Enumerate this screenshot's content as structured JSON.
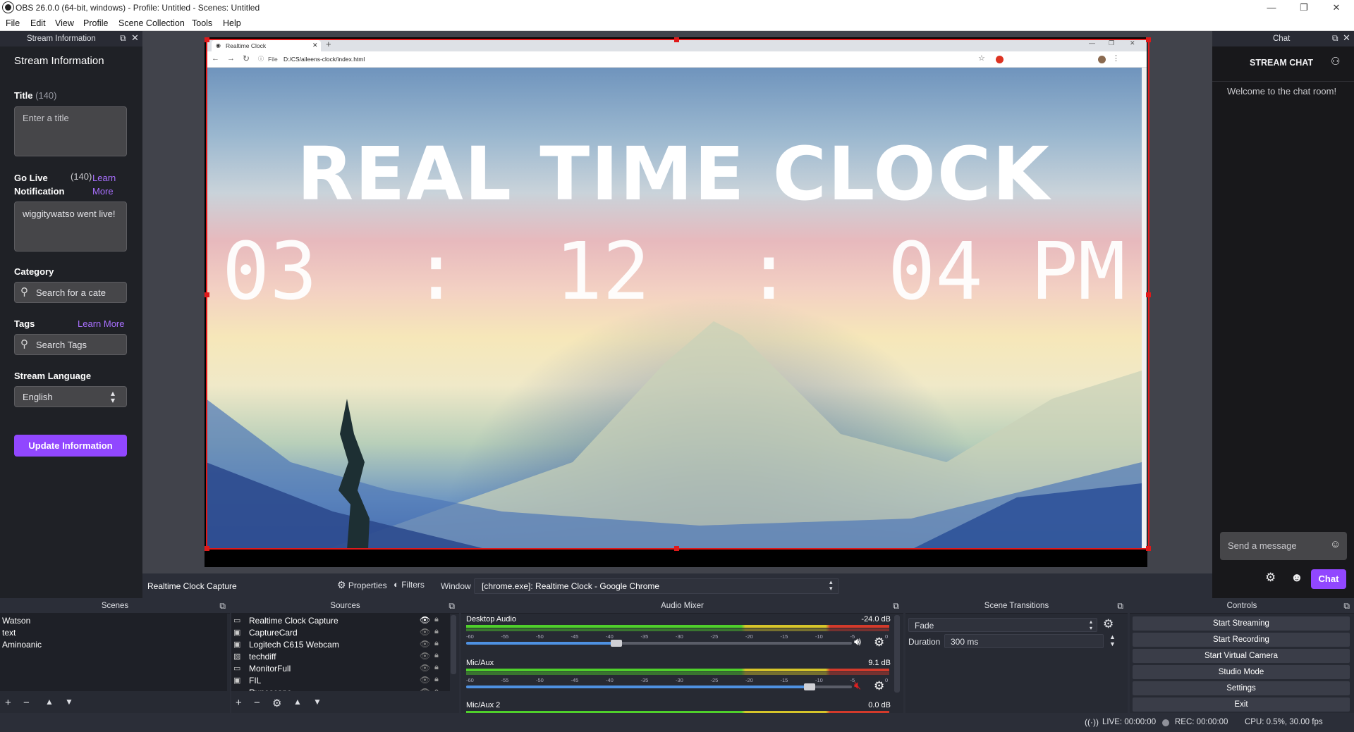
{
  "window": {
    "title": "OBS 26.0.0 (64-bit, windows) - Profile: Untitled - Scenes: Untitled",
    "minimize": "—",
    "restore": "❐",
    "close": "✕"
  },
  "menu": [
    "File",
    "Edit",
    "View",
    "Profile",
    "Scene Collection",
    "Tools",
    "Help"
  ],
  "stream_info": {
    "dock_title": "Stream Information",
    "heading": "Stream Information",
    "title_label": "Title",
    "title_count": "(140)",
    "title_placeholder": "Enter a title",
    "golive_label": "Go Live Notification",
    "golive_count": "(140)",
    "learn_more": "Learn More",
    "golive_value": "wiggitywatso went live!",
    "category_label": "Category",
    "category_placeholder": "Search for a cate",
    "tags_label": "Tags",
    "tags_learn_more": "Learn More",
    "tags_placeholder": "Search Tags",
    "language_label": "Stream Language",
    "language_value": "English",
    "update_button": "Update Information"
  },
  "browser": {
    "tab_title": "Realtime Clock",
    "url_prefix": "File",
    "url": "D:/CS/aileens-clock/index.html"
  },
  "clock": {
    "title": "REAL TIME CLOCK",
    "hours": "03",
    "minutes": "12",
    "seconds": "04",
    "ampm": "PM",
    "sep": ":"
  },
  "chat": {
    "dock_title": "Chat",
    "header": "STREAM CHAT",
    "welcome": "Welcome to the chat room!",
    "input_placeholder": "Send a message",
    "chat_button": "Chat"
  },
  "source_toolbar": {
    "source_name": "Realtime Clock Capture",
    "properties": "Properties",
    "filters": "Filters",
    "window_label": "Window",
    "window_value": "[chrome.exe]: Realtime Clock - Google Chrome"
  },
  "scenes": {
    "title": "Scenes",
    "items": [
      "Watson",
      "text",
      "Aminoanic"
    ]
  },
  "sources": {
    "title": "Sources",
    "items": [
      "Realtime Clock Capture",
      "CaptureCard",
      "Logitech C615 Webcam",
      "techdiff",
      "MonitorFull",
      "FIL",
      "Runescape"
    ]
  },
  "audio": {
    "title": "Audio Mixer",
    "ticks": [
      "-60",
      "-55",
      "-50",
      "-45",
      "-40",
      "-35",
      "-30",
      "-25",
      "-20",
      "-15",
      "-10",
      "-5",
      "0"
    ],
    "channels": [
      {
        "name": "Desktop Audio",
        "db": "-24.0 dB",
        "level": 0.39,
        "muted": false
      },
      {
        "name": "Mic/Aux",
        "db": "9.1 dB",
        "level": 0.89,
        "muted": true
      },
      {
        "name": "Mic/Aux 2",
        "db": "0.0 dB"
      }
    ]
  },
  "transitions": {
    "title": "Scene Transitions",
    "value": "Fade",
    "duration_label": "Duration",
    "duration_value": "300 ms"
  },
  "controls": {
    "title": "Controls",
    "buttons": [
      "Start Streaming",
      "Start Recording",
      "Start Virtual Camera",
      "Studio Mode",
      "Settings",
      "Exit"
    ]
  },
  "status": {
    "live": "LIVE: 00:00:00",
    "rec": "REC: 00:00:00",
    "cpu": "CPU: 0.5%, 30.00 fps"
  },
  "colors": {
    "accent": "#9147ff",
    "selection": "#e0191a",
    "slider": "#4e91e2"
  }
}
